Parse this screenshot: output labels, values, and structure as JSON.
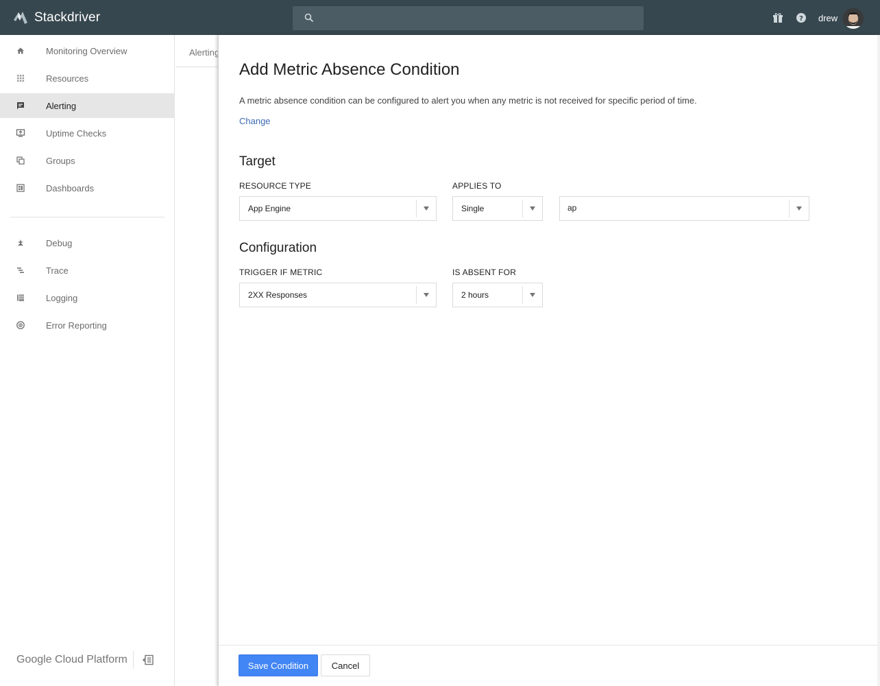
{
  "app": {
    "name": "Stackdriver",
    "user": "drew",
    "search_placeholder": ""
  },
  "sidebar": {
    "items": [
      {
        "label": "Monitoring Overview",
        "icon": "home-icon"
      },
      {
        "label": "Resources",
        "icon": "grid-icon"
      },
      {
        "label": "Alerting",
        "icon": "alert-chat-icon",
        "active": true
      },
      {
        "label": "Uptime Checks",
        "icon": "monitor-icon"
      },
      {
        "label": "Groups",
        "icon": "groups-icon"
      },
      {
        "label": "Dashboards",
        "icon": "dashboard-icon"
      },
      {
        "label": "Debug",
        "icon": "debug-icon"
      },
      {
        "label": "Trace",
        "icon": "trace-icon"
      },
      {
        "label": "Logging",
        "icon": "logging-icon"
      },
      {
        "label": "Error Reporting",
        "icon": "error-reporting-icon"
      }
    ],
    "footer_brand": "Google Cloud Platform"
  },
  "background_tab": "Alerting",
  "dialog": {
    "title": "Add Metric Absence Condition",
    "description": "A metric absence condition can be configured to alert you when any metric is not received for specific period of time.",
    "change_link": "Change",
    "target": {
      "title": "Target",
      "resource_type_label": "RESOURCE TYPE",
      "resource_type_value": "App Engine",
      "applies_to_label": "APPLIES TO",
      "applies_to_value": "Single",
      "resource_input_value": "ap"
    },
    "configuration": {
      "title": "Configuration",
      "trigger_label": "TRIGGER IF METRIC",
      "trigger_value": "2XX Responses",
      "absent_for_label": "IS ABSENT FOR",
      "absent_for_value": "2 hours"
    },
    "buttons": {
      "save": "Save Condition",
      "cancel": "Cancel"
    }
  },
  "colors": {
    "topbar": "#37474f",
    "primary_button": "#4285f4",
    "link": "#3d6bb3"
  }
}
